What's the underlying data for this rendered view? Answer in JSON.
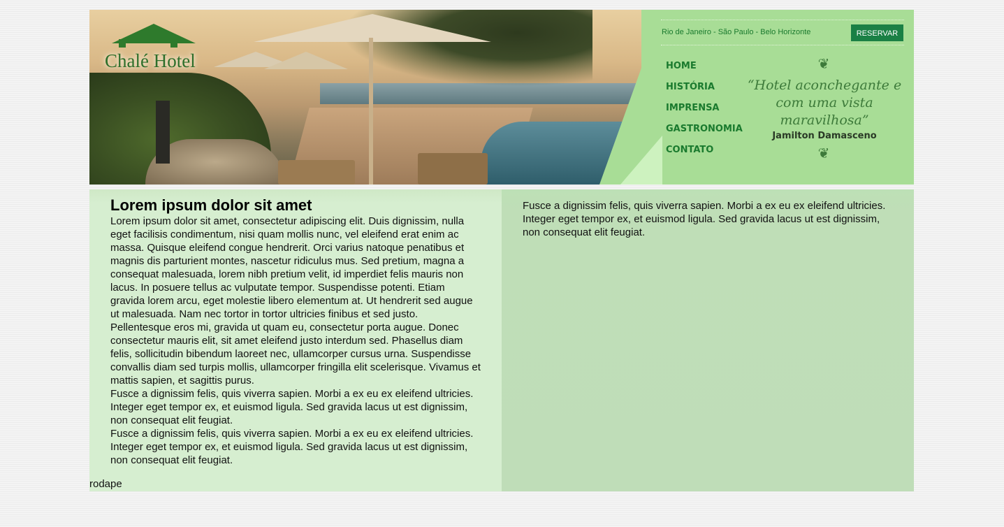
{
  "header": {
    "logo_text": "Chalé Hotel",
    "cities": "Rio de Janeiro - São Paulo - Belo Horizonte",
    "reserve_label": "RESERVAR",
    "nav": [
      "HOME",
      "HISTÓRIA",
      "IMPRENSA",
      "GASTRONOMIA",
      "CONTATO"
    ],
    "quote": "“Hotel aconchegante e com uma vista maravilhosa”",
    "quote_author": "Jamilton Damasceno",
    "ornament": "❦",
    "colors": {
      "accent_green": "#1a8045",
      "header_bg": "#a8dd96",
      "text_green": "#1a7a2e"
    }
  },
  "main": {
    "title": "Lorem ipsum dolor sit amet",
    "paragraph_1": "Lorem ipsum dolor sit amet, consectetur adipiscing elit. Duis dignissim, nulla eget facilisis condimentum, nisi quam mollis nunc, vel eleifend erat enim ac massa. Quisque eleifend congue hendrerit. Orci varius natoque penatibus et magnis dis parturient montes, nascetur ridiculus mus. Sed pretium, magna a consequat malesuada, lorem nibh pretium velit, id imperdiet felis mauris non lacus. In posuere tellus ac vulputate tempor. Suspendisse potenti. Etiam gravida lorem arcu, eget molestie libero elementum at. Ut hendrerit sed augue ut malesuada. Nam nec tortor in tortor ultricies finibus et sed justo. Pellentesque eros mi, gravida ut quam eu, consectetur porta augue. Donec consectetur mauris elit, sit amet eleifend justo interdum sed. Phasellus diam felis, sollicitudin bibendum laoreet nec, ullamcorper cursus urna. Suspendisse convallis diam sed turpis mollis, ullamcorper fringilla elit scelerisque. Vivamus et mattis sapien, et sagittis purus.",
    "paragraph_2": "Fusce a dignissim felis, quis viverra sapien. Morbi a ex eu ex eleifend ultricies. Integer eget tempor ex, et euismod ligula. Sed gravida lacus ut est dignissim, non consequat elit feugiat.",
    "paragraph_3": "Fusce a dignissim felis, quis viverra sapien. Morbi a ex eu ex eleifend ultricies. Integer eget tempor ex, et euismod ligula. Sed gravida lacus ut est dignissim, non consequat elit feugiat."
  },
  "sidebar": {
    "paragraph": "Fusce a dignissim felis, quis viverra sapien. Morbi a ex eu ex eleifend ultricies. Integer eget tempor ex, et euismod ligula. Sed gravida lacus ut est dignissim, non consequat elit feugiat."
  },
  "footer": {
    "text": "rodape"
  }
}
